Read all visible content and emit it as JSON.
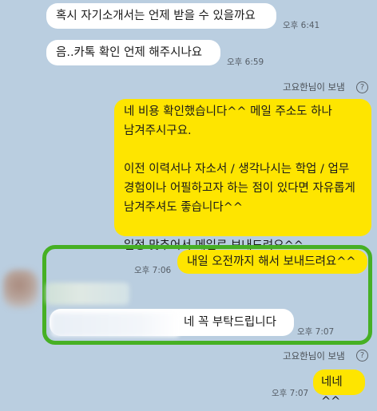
{
  "messages": {
    "m1": {
      "text": "혹시 자기소개서는 언제 받을 수 있을까요",
      "time": "오후 6:41"
    },
    "m2": {
      "text": "음..카톡 확인 언제 해주시나요",
      "time": "오후 6:59"
    },
    "sent_note_1": "고요한님이 보냄",
    "m3": {
      "text": "네 비용 확인했습니다^^ 메일 주소도 하나 남겨주시구요.\n\n이전 이력서나 자소서 / 생각나시는 학업 / 업무 경험이나 어필하고자 하는 점이 있다면 자유롭게 남겨주셔도 좋습니다^^\n\n일정 맞추어서 메일로 보내드려요^^"
    },
    "m4": {
      "text": "내일 오전까지 해서 보내드려요^^",
      "time": "오후 7:06"
    },
    "m5": {
      "text": "네 꼭 부탁드립니다",
      "time": "오후 7:07"
    },
    "sent_note_2": "고요한님이 보냄",
    "m6": {
      "text": "네네^^",
      "time": "오후 7:07"
    }
  },
  "icons": {
    "help": "question-circle-icon"
  },
  "colors": {
    "background": "#bacee0",
    "incoming_bubble": "#ffffff",
    "outgoing_bubble": "#fee500",
    "highlight_border": "#46b024"
  }
}
